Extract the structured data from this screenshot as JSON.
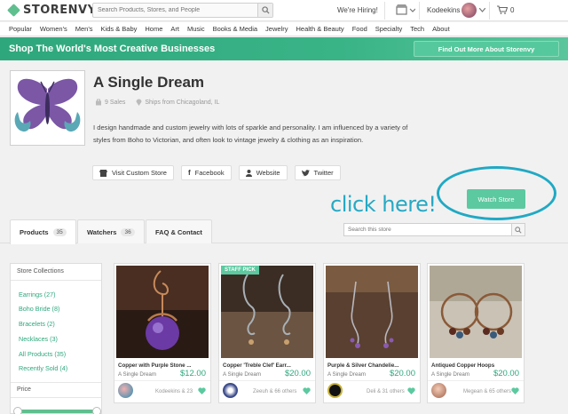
{
  "topbar": {
    "logo": "STORENVY",
    "search_placeholder": "Search Products, Stores, and People",
    "hiring": "We're Hiring!",
    "username": "Kodeekins",
    "cart_count": "0"
  },
  "catnav": [
    "Popular",
    "Women's",
    "Men's",
    "Kids & Baby",
    "Home",
    "Art",
    "Music",
    "Books & Media",
    "Jewelry",
    "Health & Beauty",
    "Food",
    "Specialty",
    "Tech",
    "About"
  ],
  "banner": {
    "title": "Shop The World's Most Creative Businesses",
    "button": "Find Out More About Storenvy"
  },
  "store": {
    "name": "A Single Dream",
    "sales": "9 Sales",
    "ships": "Ships from Chicagoland, IL",
    "description": "I design handmade and custom jewelry with lots of sparkle and personality. I am influenced by a variety of styles from Boho to Victorian, and often look to vintage jewelry & clothing as an inspiration.",
    "social": [
      "Visit Custom Store",
      "Facebook",
      "Website",
      "Twitter"
    ],
    "watch": "Watch Store",
    "annotation": "click here!"
  },
  "tabs": [
    {
      "label": "Products",
      "count": "35"
    },
    {
      "label": "Watchers",
      "count": "36"
    },
    {
      "label": "FAQ & Contact",
      "count": ""
    }
  ],
  "store_search_placeholder": "Search this store",
  "sidebar": {
    "heading": "Store Collections",
    "items": [
      "Earrings (27)",
      "Boho Bride (8)",
      "Bracelets (2)",
      "Necklaces (3)",
      "All Products (35)",
      "Recently Sold (4)"
    ],
    "price_heading": "Price"
  },
  "products": [
    {
      "title": "Copper with Purple Stone ...",
      "shop": "A Single Dream",
      "price": "$12.00",
      "favs": "Kodeekins & 23",
      "staff_pick": ""
    },
    {
      "title": "Copper 'Treble Clef' Earr...",
      "shop": "A Single Dream",
      "price": "$20.00",
      "favs": "Zeeuh & 66 others",
      "staff_pick": "STAFF PICK"
    },
    {
      "title": "Purple & Silver Chandelie...",
      "shop": "A Single Dream",
      "price": "$20.00",
      "favs": "Deli & 31 others",
      "staff_pick": ""
    },
    {
      "title": "Antiqued Copper Hoops",
      "shop": "A Single Dream",
      "price": "$20.00",
      "favs": "Megean & 65 others",
      "staff_pick": ""
    }
  ],
  "colors": {
    "accent": "#5cc9a0",
    "link": "#2fa77d",
    "annotation": "#20a9c4"
  }
}
